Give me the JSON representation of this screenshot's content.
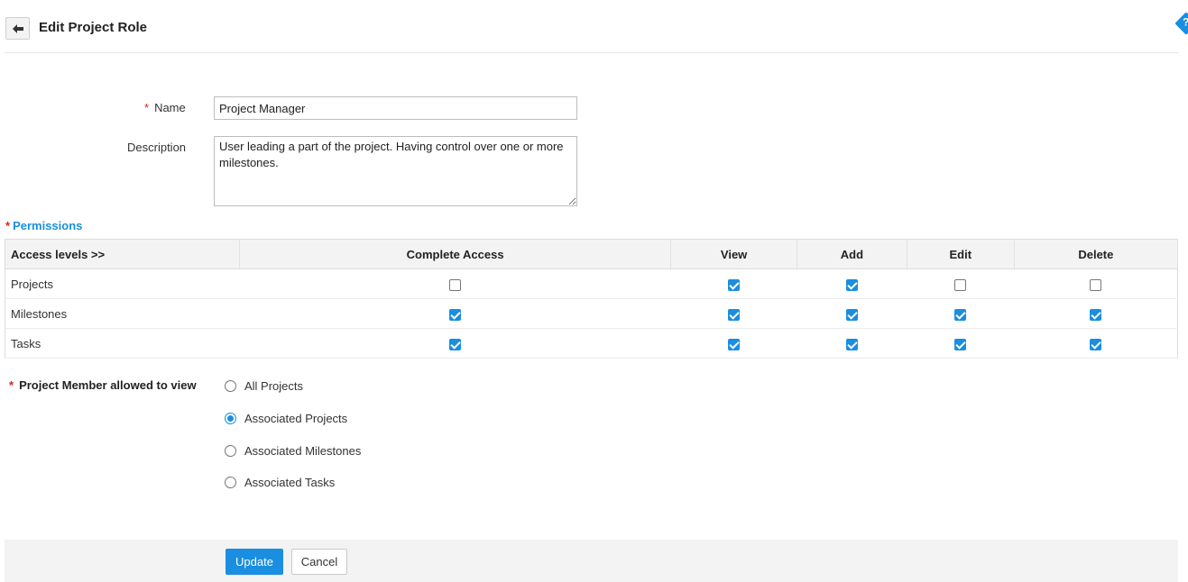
{
  "header": {
    "title": "Edit Project Role",
    "back_icon": "arrow-left-icon",
    "help_icon": "help-icon",
    "help_glyph": "?"
  },
  "form": {
    "name_label": "Name",
    "name_value": "Project Manager",
    "description_label": "Description",
    "description_value": "User leading a part of the project. Having control over one or more milestones.",
    "required_mark": "*"
  },
  "permissions": {
    "title": "Permissions",
    "columns": [
      "Access levels >>",
      "Complete Access",
      "View",
      "Add",
      "Edit",
      "Delete"
    ],
    "rows": [
      {
        "name": "Projects",
        "values": [
          false,
          true,
          true,
          false,
          false
        ]
      },
      {
        "name": "Milestones",
        "values": [
          true,
          true,
          true,
          true,
          true
        ]
      },
      {
        "name": "Tasks",
        "values": [
          true,
          true,
          true,
          true,
          true
        ]
      }
    ]
  },
  "project_member": {
    "label": "Project Member allowed to view",
    "options": [
      "All Projects",
      "Associated Projects",
      "Associated Milestones",
      "Associated Tasks"
    ],
    "selected": "Associated Projects"
  },
  "footer": {
    "update_label": "Update",
    "cancel_label": "Cancel"
  },
  "colors": {
    "accent": "#1a8ee0",
    "required": "#e0201e",
    "header_bg": "#f3f3f3"
  }
}
